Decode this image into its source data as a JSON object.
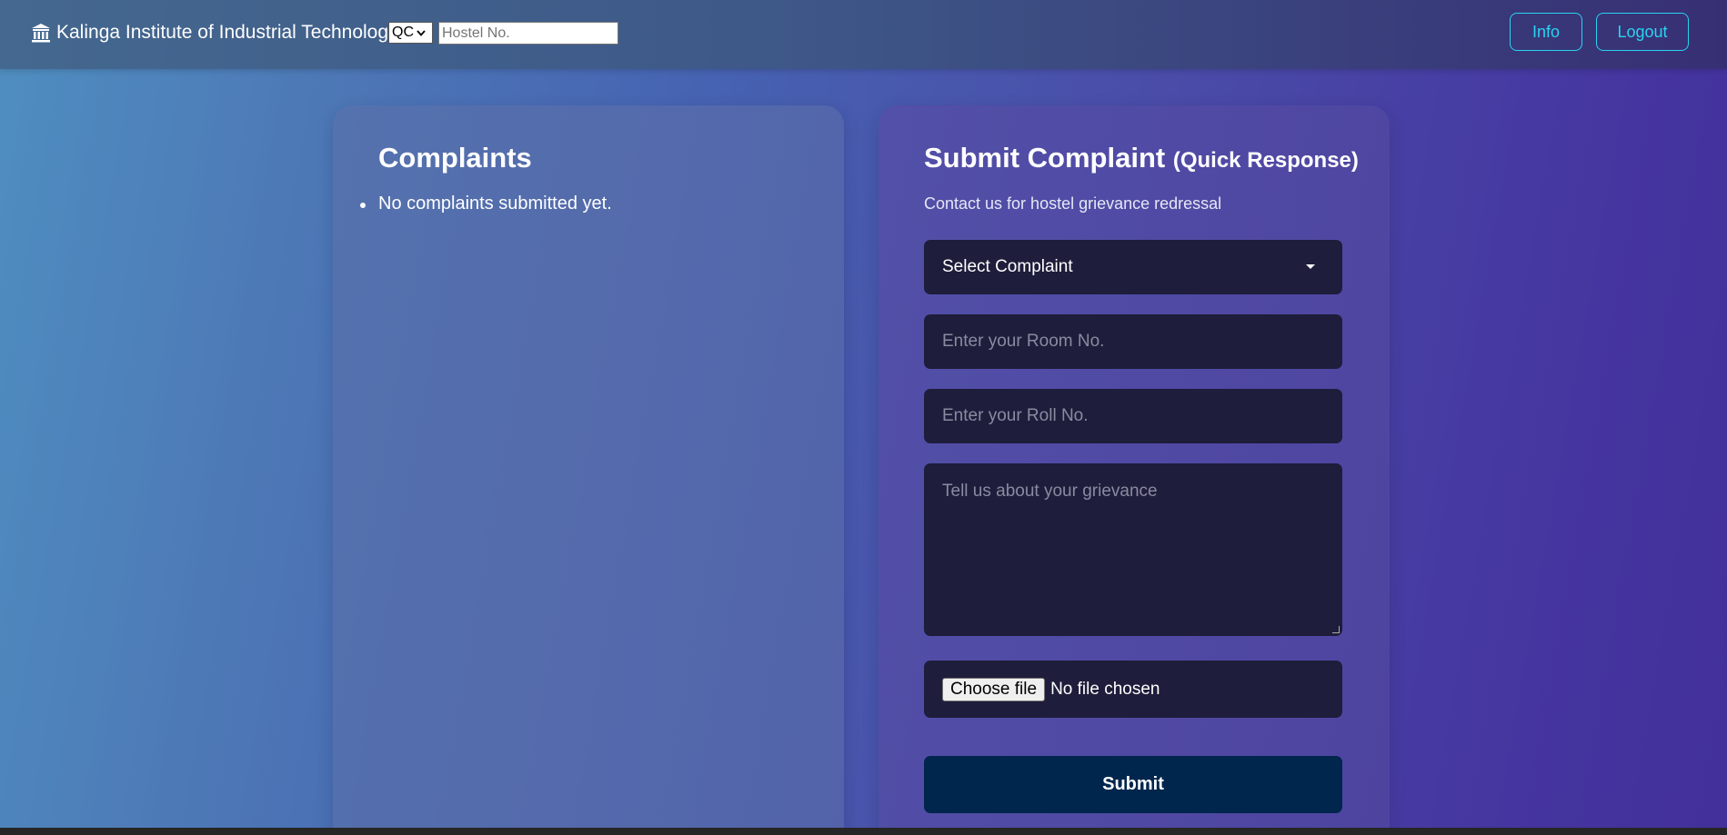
{
  "header": {
    "brand_name": "Kalinga Institute of Industrial Technology",
    "brand_icon": "institution-icon",
    "quota_select_value": "QC",
    "hostel_placeholder": "Hostel No.",
    "info_label": "Info",
    "logout_label": "Logout",
    "accent_color": "#2ad3f0"
  },
  "complaints_panel": {
    "title": "Complaints",
    "items": [
      "No complaints submitted yet."
    ]
  },
  "form": {
    "title": "Submit Complaint",
    "title_note": "(Quick Response)",
    "subtitle": "Contact us for hostel grievance redressal",
    "select_label": "Select Complaint",
    "room_placeholder": "Enter your Room No.",
    "roll_placeholder": "Enter your Roll No.",
    "grievance_placeholder": "Tell us about your grievance",
    "file_button_label": "Choose file",
    "file_status": "No file chosen",
    "submit_label": "Submit",
    "submit_color": "#01264d"
  }
}
